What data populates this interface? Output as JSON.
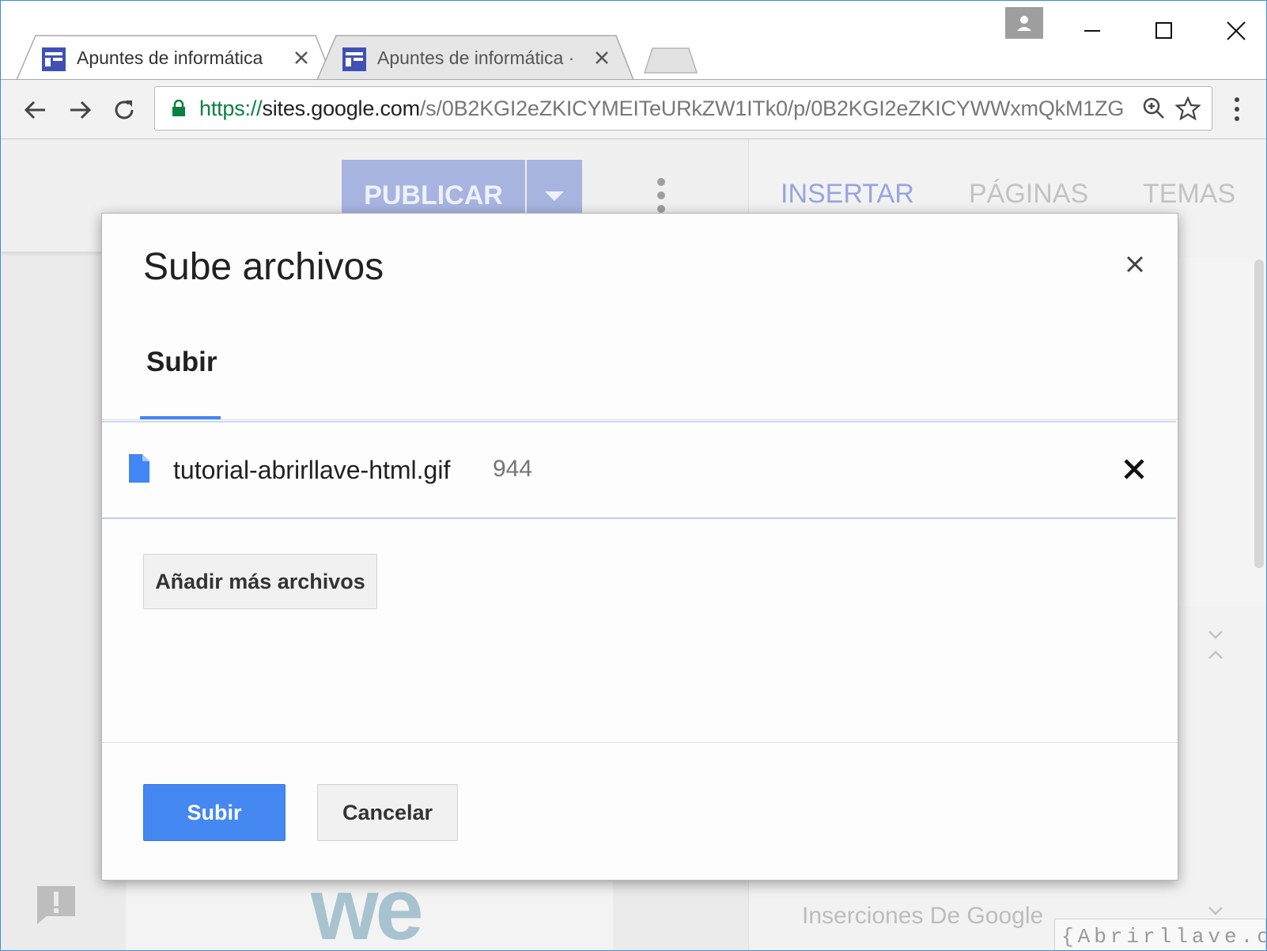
{
  "browser": {
    "tabs": [
      {
        "title": "Apuntes de informática",
        "active": true
      },
      {
        "title": "Apuntes de informática ·",
        "active": false
      }
    ],
    "url": {
      "scheme": "https://",
      "host": "sites.google.com",
      "path": "/s/0B2KGI2eZKICYMEITeURkZW1ITk0/p/0B2KGI2eZKICYWWxmQkM1ZG"
    },
    "icons": {
      "back": "arrow-left-icon",
      "forward": "arrow-right-icon",
      "reload": "reload-icon",
      "lock": "lock-icon",
      "zoom": "zoom-icon",
      "bookmark": "star-icon",
      "menu": "kebab-menu-icon"
    }
  },
  "editor": {
    "publish_label": "PUBLICAR",
    "right_tabs": [
      {
        "label": "INSERTAR",
        "active": true
      },
      {
        "label": "PÁGINAS",
        "active": false
      },
      {
        "label": "TEMAS",
        "active": false
      }
    ],
    "insertions_label": "Inserciones De Google",
    "page_text": "we"
  },
  "dialog": {
    "title": "Sube archivos",
    "tab_label": "Subir",
    "file": {
      "name": "tutorial-abrirllave-html.gif",
      "size": "944"
    },
    "add_more_label": "Añadir más archivos",
    "submit_label": "Subir",
    "cancel_label": "Cancelar"
  },
  "watermark": "{Abrirllave.com",
  "colors": {
    "accent": "#4285f4",
    "primary_button": "#4688f1",
    "publish_dimmed": "#a7b4e0"
  }
}
